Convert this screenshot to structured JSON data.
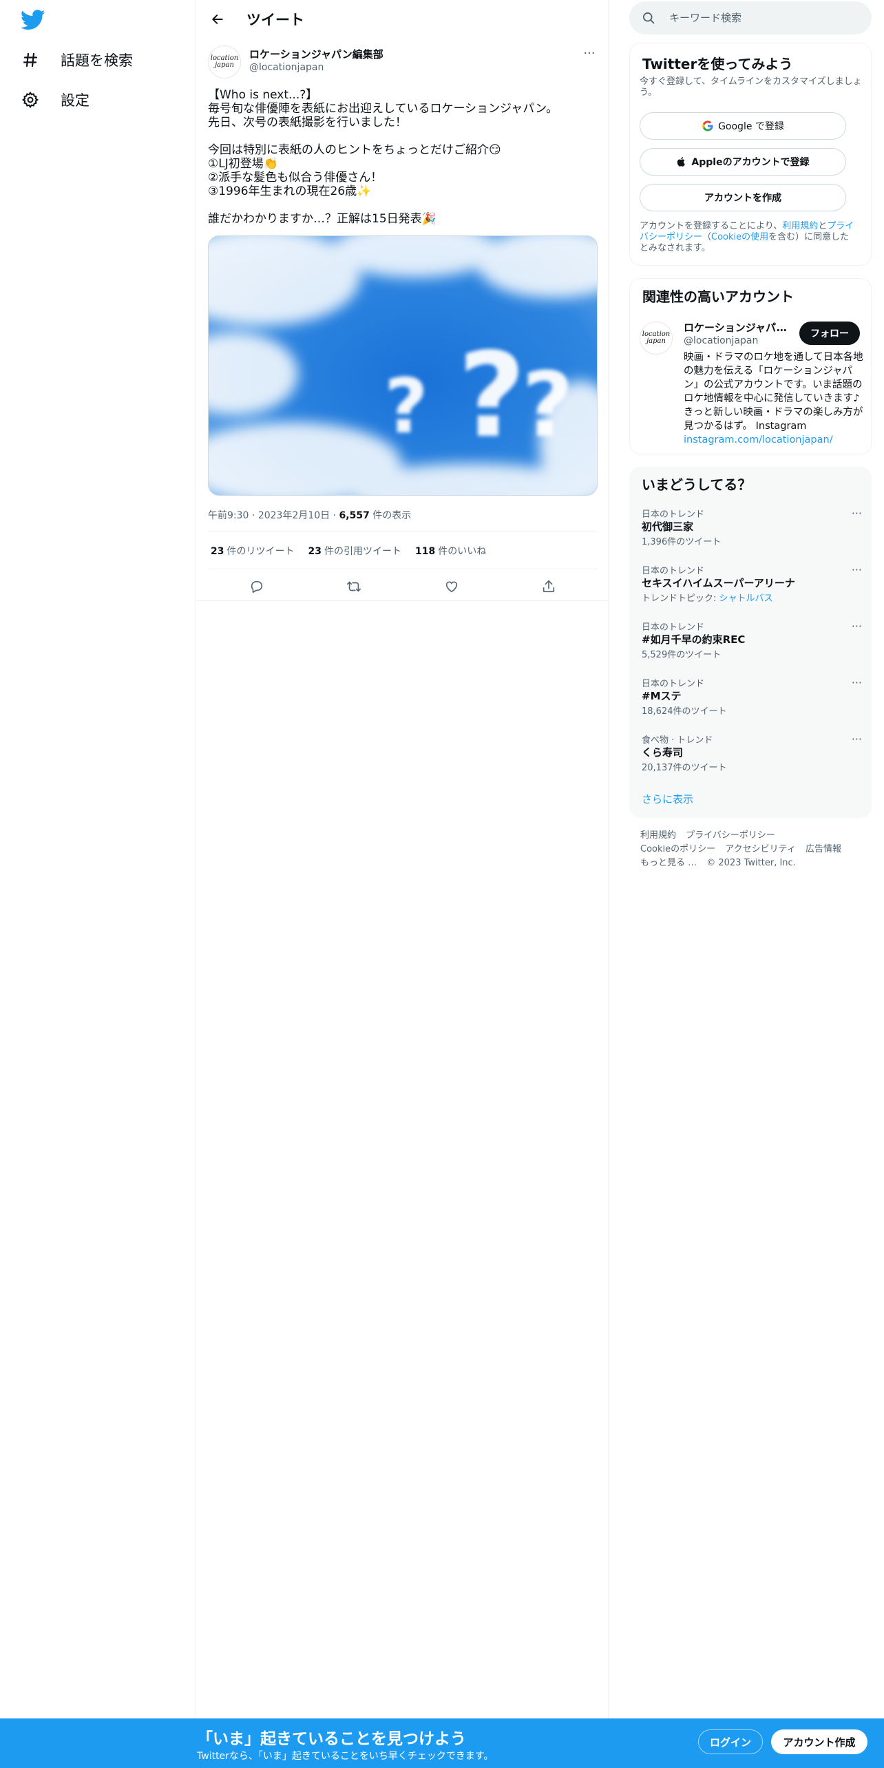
{
  "nav": {
    "logo": "twitter-bird-icon",
    "items": [
      {
        "label": "話題を検索",
        "icon": "hashtag-icon"
      },
      {
        "label": "設定",
        "icon": "gear-icon"
      }
    ]
  },
  "header": {
    "title": "ツイート"
  },
  "tweet": {
    "avatar_text": "location japan",
    "author_name": "ロケーションジャパン編集部",
    "author_handle": "@locationjapan",
    "lines": [
      "【Who is next...?】",
      "毎号旬な俳優陣を表紙にお出迎えしているロケーションジャパン。",
      "先日、次号の表紙撮影を行いました！",
      "",
      "今回は特別に表紙の人のヒントをちょっとだけご紹介😏",
      "①LJ初登場👏",
      "②派手な髪色も似合う俳優さん！",
      "③1996年生まれの現在26歳✨",
      "",
      "誰だかわかりますか…？正解は15日発表🎉"
    ],
    "time": "午前9:30",
    "date": "2023年2月10日",
    "views_count": "6,557",
    "views_label": "件の表示",
    "retweets_count": "23",
    "retweets_label": "件のリツイート",
    "quotes_count": "23",
    "quotes_label": "件の引用ツイート",
    "likes_count": "118",
    "likes_label": "件のいいね"
  },
  "search": {
    "placeholder": "キーワード検索"
  },
  "signup": {
    "title": "Twitterを使ってみよう",
    "subtitle": "今すぐ登録して、タイムラインをカスタマイズしましょう。",
    "google_label": "Google で登録",
    "apple_label": "Appleのアカウントで登録",
    "create_label": "アカウントを作成",
    "terms_pre": "アカウントを登録することにより、",
    "terms_link1": "利用規約",
    "terms_and": "と",
    "terms_link2": "プライバシーポリシー",
    "terms_paren_open": "（",
    "terms_link3": "Cookieの使用",
    "terms_post": "を含む）に同意したとみなされます。"
  },
  "related": {
    "title": "関連性の高いアカウント",
    "avatar_text": "location japan",
    "name": "ロケーションジャパン編集部",
    "handle": "@locationjapan",
    "follow_label": "フォロー",
    "bio": "映画・ドラマのロケ地を通して日本各地の魅力を伝える「ロケーションジャパン」の公式アカウントです。いま話題のロケ地情報を中心に発信していきます♪きっと新しい映画・ドラマの楽しみ方が見つかるはず。 Instagram",
    "bio_link": "instagram.com/locationjapan/"
  },
  "trends": {
    "title": "いまどうしてる？",
    "items": [
      {
        "context": "日本のトレンド",
        "name": "初代御三家",
        "sub": "1,396件のツイート",
        "sub_link": ""
      },
      {
        "context": "日本のトレンド",
        "name": "セキスイハイムスーパーアリーナ",
        "sub": "トレンドトピック: ",
        "sub_link": "シャトルバス"
      },
      {
        "context": "日本のトレンド",
        "name": "#如月千早の約束REC",
        "sub": "5,529件のツイート",
        "sub_link": ""
      },
      {
        "context": "日本のトレンド",
        "name": "#Mステ",
        "sub": "18,624件のツイート",
        "sub_link": ""
      },
      {
        "context": "食べ物 · トレンド",
        "name": "くら寿司",
        "sub": "20,137件のツイート",
        "sub_link": ""
      }
    ],
    "show_more": "さらに表示"
  },
  "footer": {
    "links": [
      "利用規約",
      "プライバシーポリシー",
      "Cookieのポリシー",
      "アクセシビリティ",
      "広告情報",
      "もっと見る …"
    ],
    "copyright": "© 2023 Twitter, Inc."
  },
  "banner": {
    "title": "「いま」起きていることを見つけよう",
    "subtitle": "Twitterなら、「いま」起きていることをいち早くチェックできます。",
    "login_label": "ログイン",
    "signup_label": "アカウント作成"
  },
  "colors": {
    "accent": "#1d9bf0",
    "text": "#0f1419",
    "muted": "#536471"
  }
}
